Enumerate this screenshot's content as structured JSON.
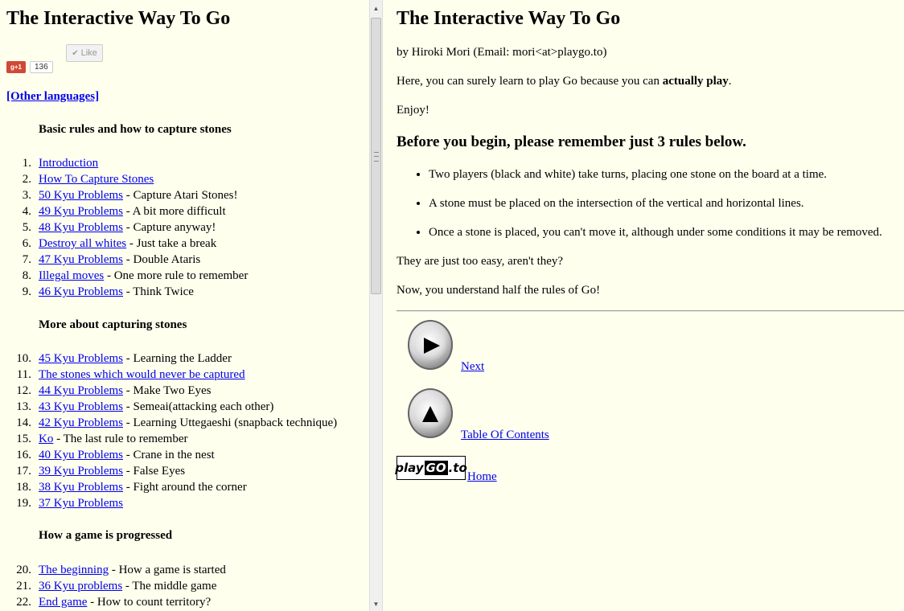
{
  "left": {
    "title": "The Interactive Way To Go",
    "gplus_label": "+1",
    "gplus_count": "136",
    "like_label": "Like",
    "other_languages": "[Other languages]",
    "sections": [
      {
        "title": "Basic rules and how to capture stones",
        "items": [
          {
            "num": "1.",
            "link": "Introduction",
            "desc": ""
          },
          {
            "num": "2.",
            "link": "How To Capture Stones",
            "desc": ""
          },
          {
            "num": "3.",
            "link": "50 Kyu Problems",
            "desc": " - Capture Atari Stones!"
          },
          {
            "num": "4.",
            "link": "49 Kyu Problems",
            "desc": " - A bit more difficult"
          },
          {
            "num": "5.",
            "link": "48 Kyu Problems",
            "desc": " - Capture anyway!"
          },
          {
            "num": "6.",
            "link": "Destroy all whites",
            "desc": " - Just take a break"
          },
          {
            "num": "7.",
            "link": "47 Kyu Problems",
            "desc": " - Double Ataris"
          },
          {
            "num": "8.",
            "link": "Illegal moves",
            "desc": " - One more rule to remember"
          },
          {
            "num": "9.",
            "link": "46 Kyu Problems",
            "desc": " - Think Twice"
          }
        ]
      },
      {
        "title": "More about capturing stones",
        "items": [
          {
            "num": "10.",
            "link": "45 Kyu Problems",
            "desc": " - Learning the Ladder"
          },
          {
            "num": "11.",
            "link": "The stones which would never be captured",
            "desc": ""
          },
          {
            "num": "12.",
            "link": "44 Kyu Problems",
            "desc": " - Make Two Eyes"
          },
          {
            "num": "13.",
            "link": "43 Kyu Problems",
            "desc": " - Semeai(attacking each other)"
          },
          {
            "num": "14.",
            "link": "42 Kyu Problems",
            "desc": " - Learning Uttegaeshi (snapback technique)"
          },
          {
            "num": "15.",
            "link": "Ko",
            "desc": " - The last rule to remember"
          },
          {
            "num": "16.",
            "link": "40 Kyu Problems",
            "desc": " - Crane in the nest"
          },
          {
            "num": "17.",
            "link": "39 Kyu Problems",
            "desc": " - False Eyes"
          },
          {
            "num": "18.",
            "link": "38 Kyu Problems",
            "desc": " - Fight around the corner"
          },
          {
            "num": "19.",
            "link": "37 Kyu Problems",
            "desc": ""
          }
        ]
      },
      {
        "title": "How a game is progressed",
        "items": [
          {
            "num": "20.",
            "link": "The beginning",
            "desc": " - How a game is started"
          },
          {
            "num": "21.",
            "link": "36 Kyu problems",
            "desc": " - The middle game"
          },
          {
            "num": "22.",
            "link": "End game",
            "desc": " - How to count territory?"
          }
        ]
      }
    ]
  },
  "right": {
    "title": "The Interactive Way To Go",
    "byline": "by Hiroki Mori (Email: mori<at>playgo.to)",
    "intro_before": "Here, you can surely learn to play Go because you can ",
    "intro_bold": "actually play",
    "intro_after": ".",
    "enjoy": "Enjoy!",
    "rules_heading": "Before you begin, please remember just 3 rules below.",
    "rules": [
      "Two players (black and white) take turns, placing one stone on the board at a time.",
      "A stone must be placed on the intersection of the vertical and horizontal lines.",
      "Once a stone is placed, you can't move it, although under some conditions it may be removed."
    ],
    "easy": "They are just too easy, aren't they?",
    "understand": "Now, you understand half the rules of Go!",
    "nav": {
      "next": "Next",
      "toc": "Table Of Contents",
      "home": "Home",
      "logo_play": "play",
      "logo_go": "GO",
      "logo_to": ".to"
    }
  },
  "colors": {
    "page_bg": "#ffffee",
    "link": "#0000ee"
  },
  "icons": [
    "play-arrow-icon",
    "up-arrow-icon",
    "scroll-up-icon",
    "scroll-down-icon"
  ]
}
